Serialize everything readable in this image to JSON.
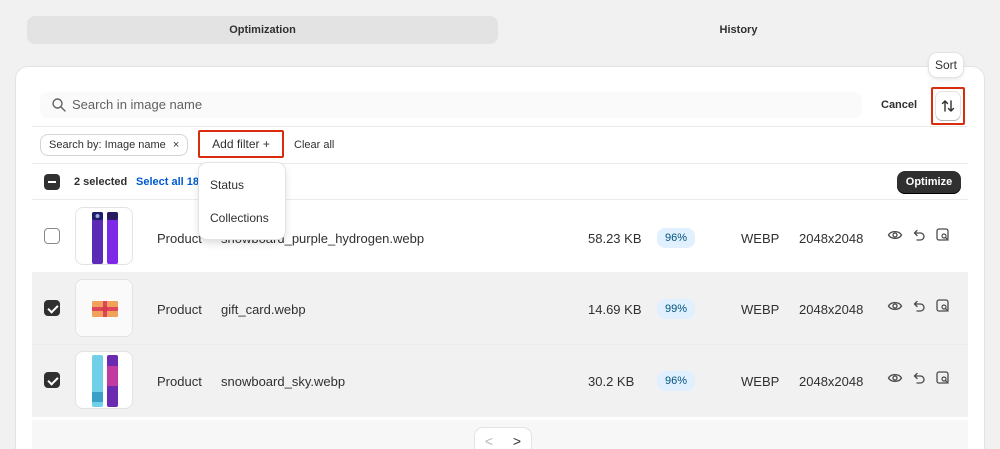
{
  "tabs": [
    {
      "label": "Optimization",
      "active": true
    },
    {
      "label": "History",
      "active": false
    }
  ],
  "search": {
    "placeholder": "Search in image name"
  },
  "toolbar": {
    "cancel_label": "Cancel",
    "sort_tooltip": "Sort",
    "sort_icon": "sort-arrows-icon"
  },
  "filters": {
    "chip_label": "Search by: Image name",
    "chip_close": "×",
    "add_filter_label": "Add filter +",
    "clear_all_label": "Clear all"
  },
  "dropdown": {
    "items": [
      "Status",
      "Collections"
    ]
  },
  "bulk": {
    "selected_label": "2 selected",
    "select_all_label": "Select all 18",
    "optimize_label": "Optimize"
  },
  "rows": [
    {
      "checked": false,
      "type": "Product",
      "name": "snowboard_purple_hydrogen.webp",
      "size": "58.23 KB",
      "percent": "96%",
      "format": "WEBP",
      "dimensions": "2048x2048",
      "thumb": "purple-snowboard"
    },
    {
      "checked": true,
      "type": "Product",
      "name": "gift_card.webp",
      "size": "14.69 KB",
      "percent": "99%",
      "format": "WEBP",
      "dimensions": "2048x2048",
      "thumb": "gift-card"
    },
    {
      "checked": true,
      "type": "Product",
      "name": "snowboard_sky.webp",
      "size": "30.2 KB",
      "percent": "96%",
      "format": "WEBP",
      "dimensions": "2048x2048",
      "thumb": "sky-snowboard"
    }
  ],
  "pagination": {
    "prev": "<",
    "next": ">"
  },
  "colors": {
    "accent_red": "#d72c0d",
    "link_blue": "#005bd3",
    "badge_bg": "#e0f0ff",
    "dark": "#303030"
  }
}
